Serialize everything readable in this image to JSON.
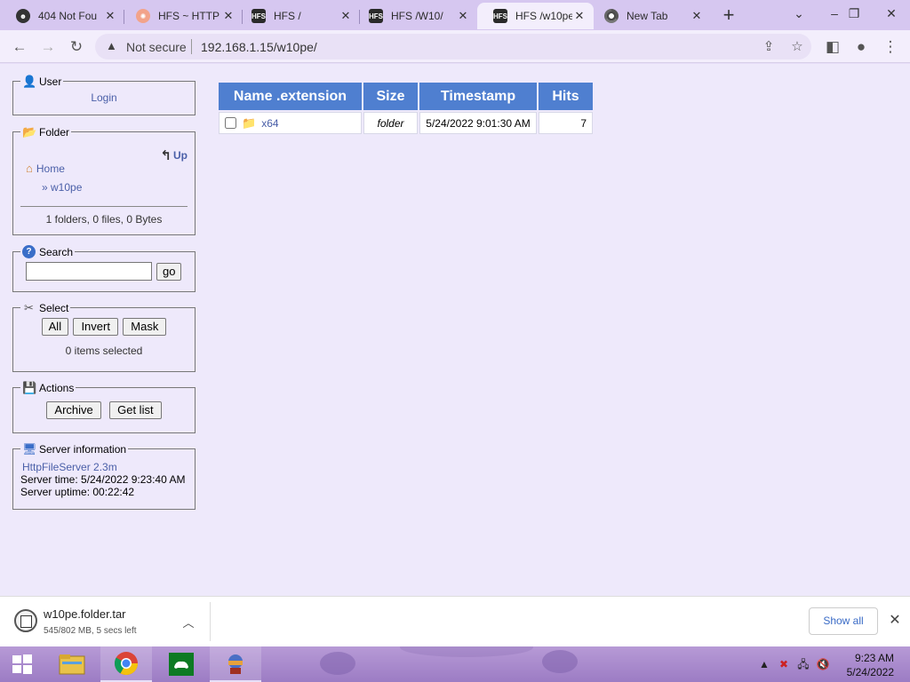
{
  "browser": {
    "tabs": [
      {
        "title": "404 Not Fou",
        "favicon": "hfs-favicon",
        "active": false
      },
      {
        "title": "HFS ~ HTTP",
        "favicon": "hfs-http-favicon",
        "active": false
      },
      {
        "title": "HFS /",
        "favicon": "hfs-favicon",
        "active": false
      },
      {
        "title": "HFS /W10/",
        "favicon": "hfs-favicon",
        "active": false
      },
      {
        "title": "HFS /w10pe",
        "favicon": "hfs-favicon",
        "active": true
      },
      {
        "title": "New Tab",
        "favicon": "chrome-favicon",
        "active": false
      }
    ],
    "security_label": "Not secure",
    "url": "192.168.1.15/w10pe/"
  },
  "sidebar": {
    "user": {
      "legend": "User",
      "login_label": "Login"
    },
    "folder": {
      "legend": "Folder",
      "up_label": "Up",
      "home_label": "Home",
      "current_label": "» w10pe",
      "summary": "1 folders, 0 files, 0 Bytes"
    },
    "search": {
      "legend": "Search",
      "value": "",
      "go_label": "go"
    },
    "select": {
      "legend": "Select",
      "all_label": "All",
      "invert_label": "Invert",
      "mask_label": "Mask",
      "status": "0 items selected"
    },
    "actions": {
      "legend": "Actions",
      "archive_label": "Archive",
      "getlist_label": "Get list"
    },
    "server": {
      "legend": "Server information",
      "software_link": "HttpFileServer 2.3m",
      "server_time": "Server time: 5/24/2022 9:23:40 AM",
      "server_uptime": "Server uptime: 00:22:42"
    }
  },
  "file_table": {
    "columns": [
      "Name .extension",
      "Size",
      "Timestamp",
      "Hits"
    ],
    "rows": [
      {
        "name": "x64",
        "size": "folder",
        "timestamp": "5/24/2022 9:01:30 AM",
        "hits": "7"
      }
    ]
  },
  "download_shelf": {
    "file_name": "w10pe.folder.tar",
    "status": "545/802 MB, 5 secs left",
    "show_all_label": "Show all"
  },
  "taskbar": {
    "time": "9:23 AM",
    "date": "5/24/2022"
  }
}
